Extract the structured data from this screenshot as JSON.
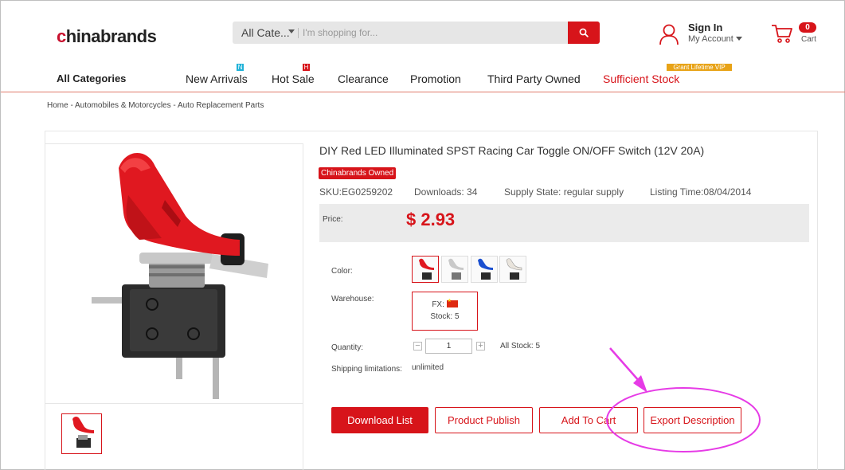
{
  "header": {
    "logo_text": "chinabrands",
    "search": {
      "category": "All Cate...",
      "placeholder": "I'm shopping for..."
    },
    "account": {
      "sign_in": "Sign In",
      "my_account": "My Account"
    },
    "cart": {
      "count": "0",
      "label": "Cart"
    }
  },
  "nav": {
    "all_categories": "All Categories",
    "items": [
      {
        "label": "New Arrivals",
        "badge": "N"
      },
      {
        "label": "Hot Sale",
        "badge": "H"
      },
      {
        "label": "Clearance"
      },
      {
        "label": "Promotion"
      },
      {
        "label": "Third Party Owned"
      },
      {
        "label": "Sufficient Stock",
        "badge": "Grant Lifetime VIP"
      }
    ]
  },
  "breadcrumb": "Home  -  Automobiles & Motorcycles  -  Auto Replacement Parts",
  "product": {
    "title": "DIY Red LED Illuminated SPST Racing Car Toggle ON/OFF Switch (12V 20A)",
    "owned_badge": "Chinabrands Owned",
    "sku": "SKU:EG0259202",
    "downloads": "Downloads: 34",
    "supply_state": "Supply State: regular supply",
    "listing_time": "Listing Time:08/04/2014",
    "price_label": "Price:",
    "price": "$ 2.93",
    "color_label": "Color:",
    "colors": [
      "red",
      "silver",
      "blue",
      "clear"
    ],
    "warehouse_label": "Warehouse:",
    "warehouse": {
      "code": "FX:",
      "stock": "Stock: 5"
    },
    "quantity_label": "Quantity:",
    "quantity": "1",
    "all_stock": "All Stock: 5",
    "shipping_label": "Shipping limitations:",
    "shipping_value": "unlimited"
  },
  "actions": {
    "download_list": "Download List",
    "product_publish": "Product Publish",
    "add_to_cart": "Add To Cart",
    "export_description": "Export Description"
  },
  "colors": {
    "brand_red": "#d7141a",
    "annotation": "#e63be6"
  }
}
